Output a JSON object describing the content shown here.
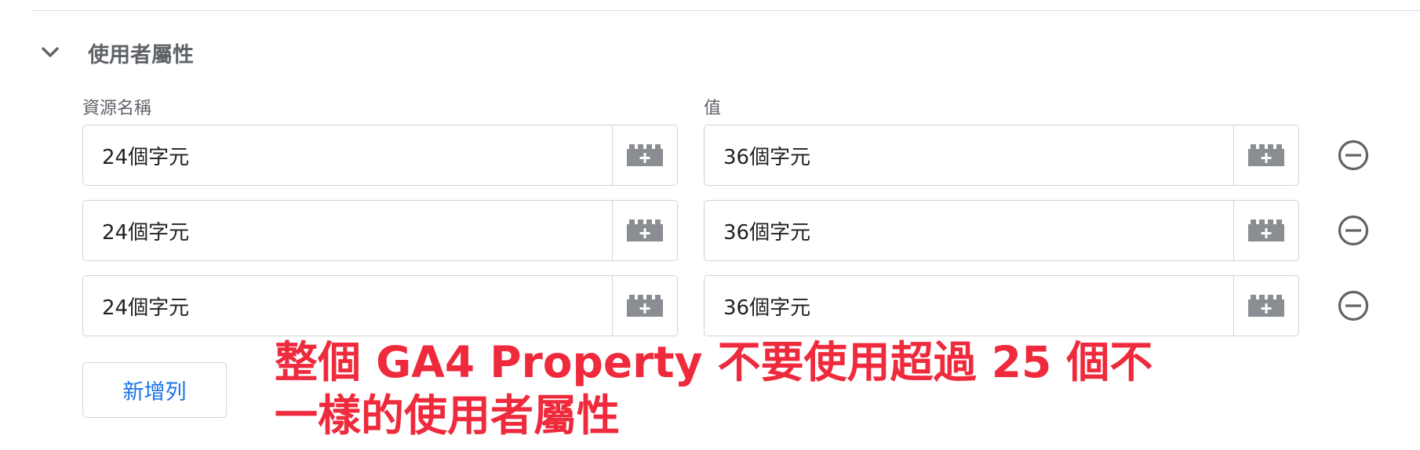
{
  "section": {
    "title": "使用者屬性",
    "toggle_icon": "chevron-down-icon"
  },
  "columns": {
    "name_label": "資源名稱",
    "value_label": "值"
  },
  "rows": [
    {
      "name": "24個字元",
      "value": "36個字元"
    },
    {
      "name": "24個字元",
      "value": "36個字元"
    },
    {
      "name": "24個字元",
      "value": "36個字元"
    }
  ],
  "icons": {
    "variable": "variable-brick-icon",
    "remove": "remove-circle-icon"
  },
  "add_row_label": "新增列",
  "annotation": {
    "line1": "整個 GA4 Property 不要使用超過 25 個不",
    "line2": "一樣的使用者屬性"
  },
  "colors": {
    "accent": "#1a73e8",
    "annotation": "#ee2a3c",
    "icon": "#8a8d91",
    "border": "#d0d3d7"
  }
}
